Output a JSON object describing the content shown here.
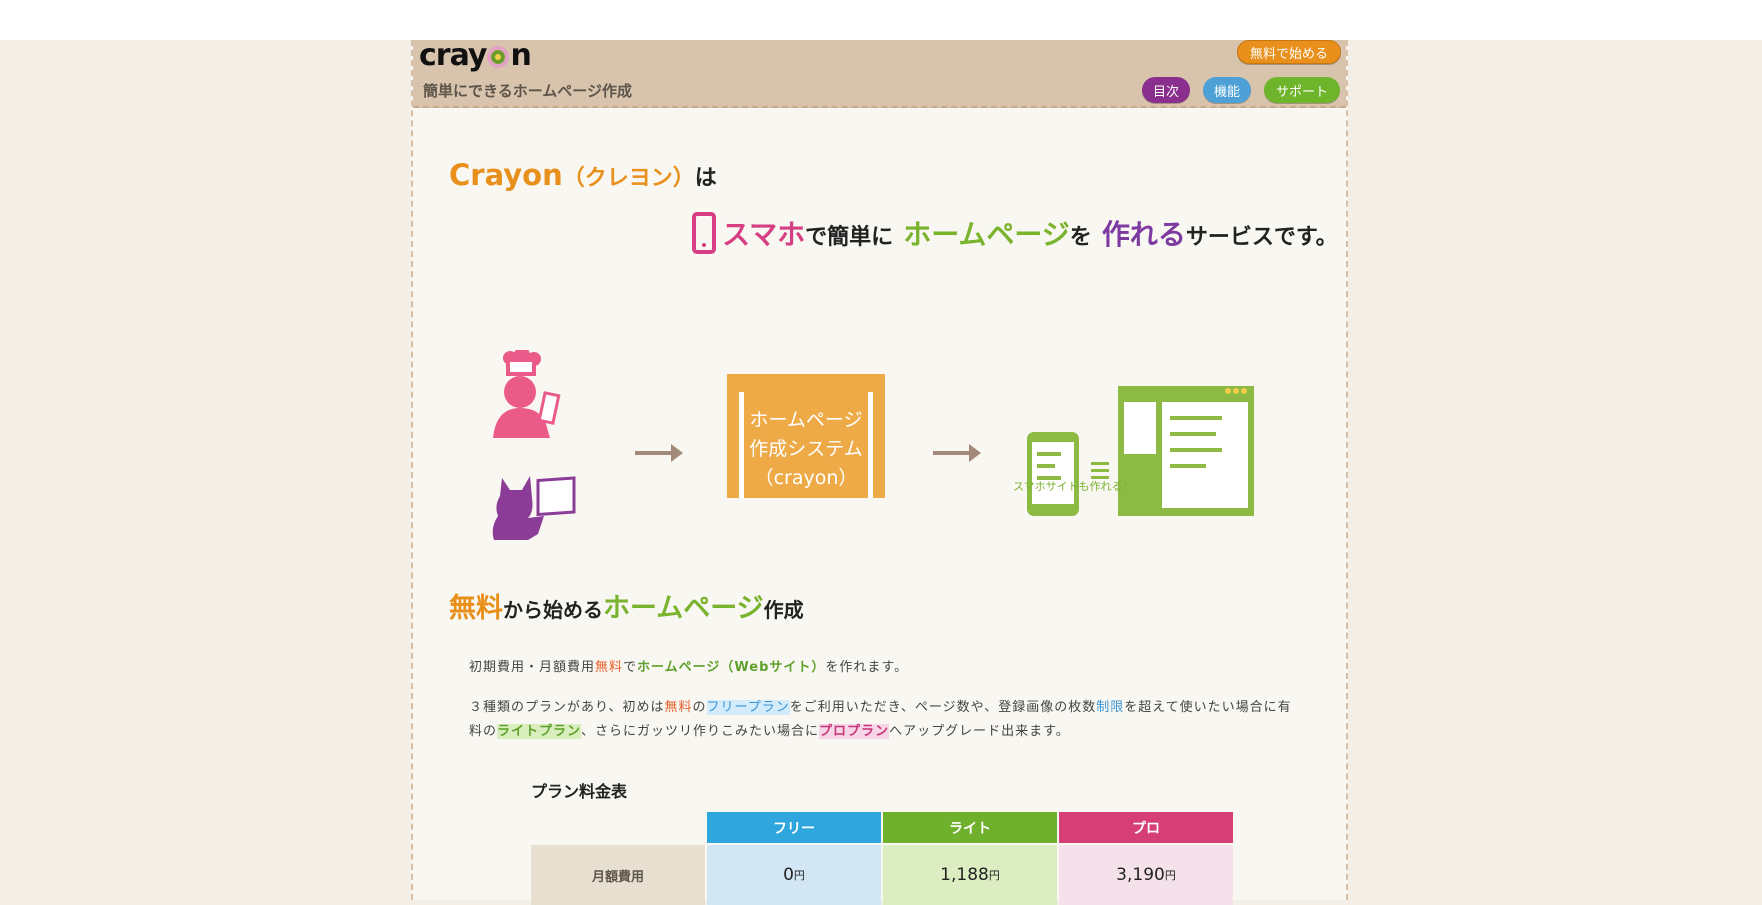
{
  "header": {
    "logo": "crayon",
    "tagline": "簡単にできるホームページ作成",
    "start_button": "無料で始める",
    "nav": {
      "toc": "目次",
      "features": "機能",
      "support": "サポート"
    }
  },
  "hero": {
    "brand": "Crayon",
    "brand_kana": "（クレヨン）",
    "ha": "は",
    "sumaho": "スマホ",
    "de_kantan_ni": "で簡単に",
    "homepage": "ホームページ",
    "wo": "を",
    "tsukureru": "作れる",
    "service": "サービスです。"
  },
  "diagram": {
    "box_lines": [
      "ホームページ",
      "作成システム",
      "（crayon）"
    ],
    "caption": "スマホサイトも作れる！"
  },
  "section": {
    "title_free": "無料",
    "title_mid": "から始める",
    "title_hp": "ホームページ",
    "title_end": "作成",
    "p1": {
      "a": "初期費用・月額費用",
      "free": "無料",
      "b": "で",
      "hp": "ホームページ（Webサイト）",
      "c": "を作れます。"
    },
    "p2": {
      "a": "３種類のプランがあり、初めは",
      "free": "無料",
      "b": "の",
      "free_plan": "フリープラン",
      "c": "をご利用いただき、ページ数や、登録画像の枚数",
      "limit": "制限",
      "d": "を超えて使いたい場合に有料の",
      "lite_plan": "ライトプラン",
      "e": "、さらにガッツリ作りこみたい場合に",
      "pro_plan": "プロプラン",
      "f": "へアップグレード出来ます。"
    }
  },
  "pricing": {
    "title": "プラン料金表",
    "columns": [
      "フリー",
      "ライト",
      "プロ"
    ],
    "column_colors": [
      "#2fa6de",
      "#6fb02c",
      "#d63f76"
    ],
    "cell_colors": [
      "#d3e6f4",
      "#dcedc2",
      "#f4e1ea"
    ],
    "row_label": "月額費用",
    "prices": [
      "0",
      "1,188",
      "3,190"
    ],
    "unit": "円"
  }
}
